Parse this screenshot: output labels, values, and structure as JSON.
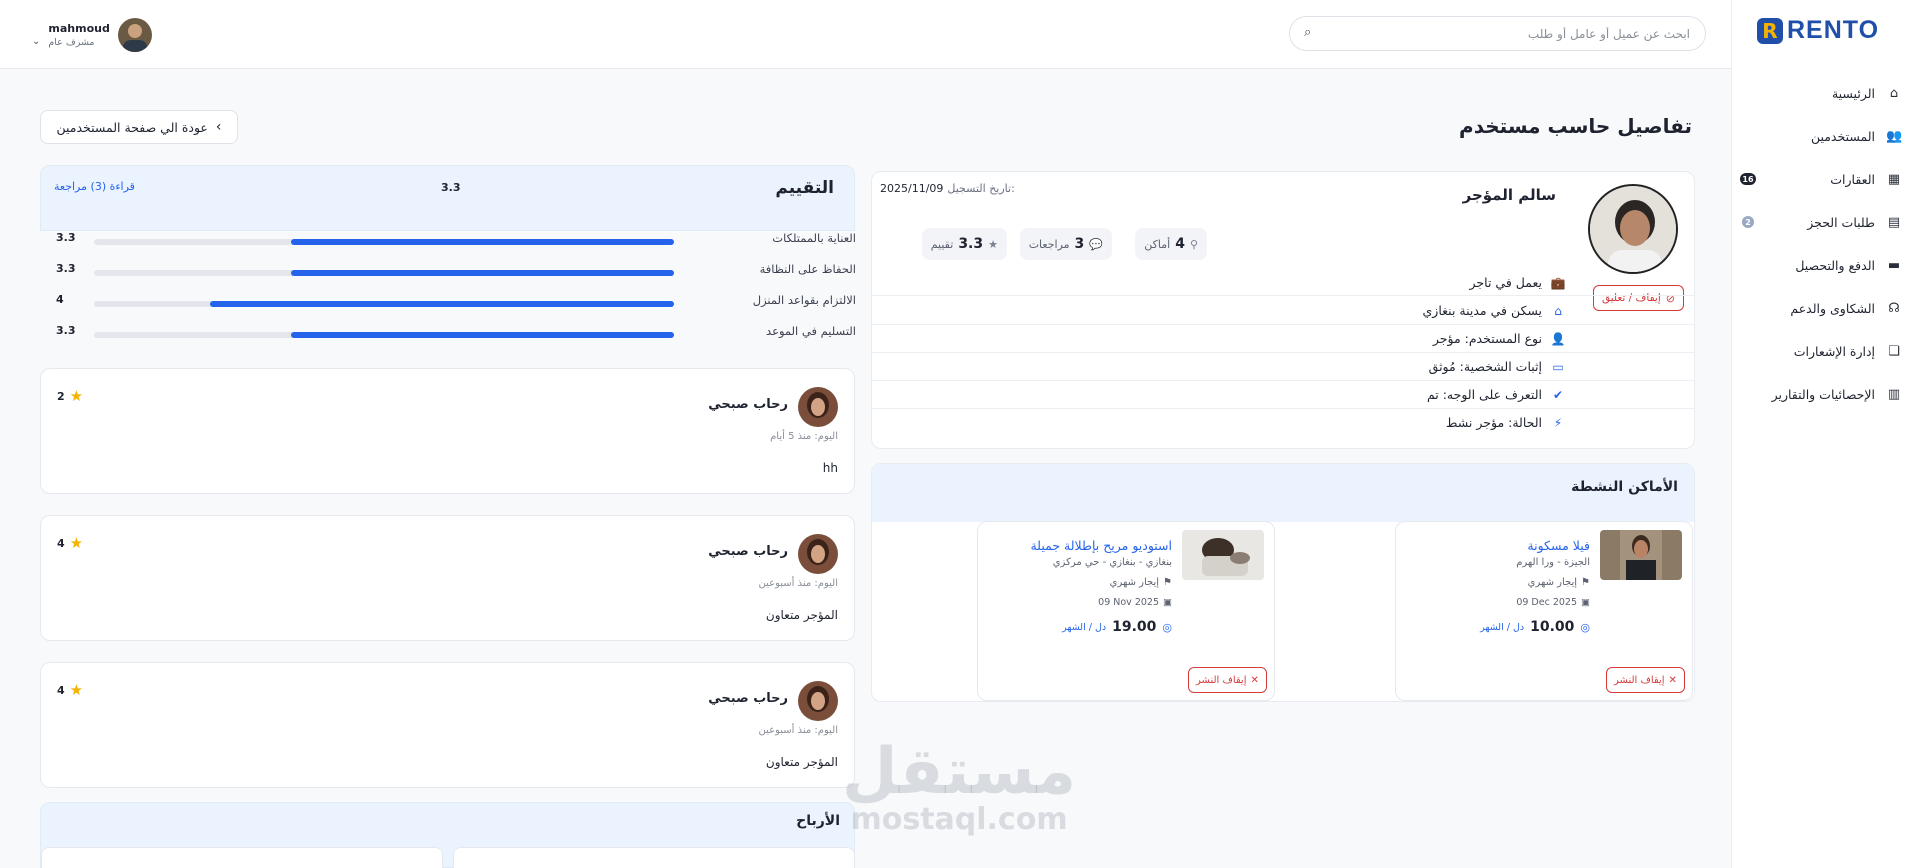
{
  "brand": {
    "name": "RENTO",
    "mark": "R"
  },
  "sidebar": {
    "items": [
      {
        "label": "الرئيسية",
        "icon": "home-icon"
      },
      {
        "label": "المستخدمين",
        "icon": "users-icon"
      },
      {
        "label": "العقارات",
        "icon": "building-icon",
        "badge": "16"
      },
      {
        "label": "طلبات الحجز",
        "icon": "clipboard-icon",
        "badge": "2"
      },
      {
        "label": "الدفع والتحصيل",
        "icon": "wallet-icon"
      },
      {
        "label": "الشكاوى والدعم",
        "icon": "headset-icon"
      },
      {
        "label": "إدارة الإشعارات",
        "icon": "gift-icon"
      },
      {
        "label": "الإحصائيات والتقارير",
        "icon": "chart-icon"
      }
    ]
  },
  "header": {
    "search_placeholder": "ابحث عن عميل أو عامل أو طلب",
    "user_name": "mahmoud",
    "user_role": "مشرف عام"
  },
  "page": {
    "title": "تفاصيل حاسب مستخدم",
    "back_label": "عودة الي صفحة المستخدمين"
  },
  "profile": {
    "name": "سالم المؤجر",
    "registered_label": "تاريخ التسجيل:",
    "registered_date": "2025/11/09",
    "suspend_label": "إيقاف / تعليق",
    "stats": [
      {
        "value": "4",
        "label": "أماكن",
        "icon": "location-pin-icon"
      },
      {
        "value": "3",
        "label": "مراجعات",
        "icon": "comments-icon"
      },
      {
        "value": "3.3",
        "label": "تقييم",
        "icon": "star-icon"
      }
    ],
    "details": [
      {
        "text": "يعمل في تاجر",
        "icon": "briefcase-icon"
      },
      {
        "text": "يسكن في مدينة بنغازي",
        "icon": "home-icon"
      },
      {
        "text": "نوع المستخدم: مؤجر",
        "icon": "user-icon"
      },
      {
        "text": "إثبات الشخصية: مُوثق",
        "icon": "id-card-icon"
      },
      {
        "text": "التعرف على الوجه: تم",
        "icon": "user-check-icon"
      },
      {
        "text": "الحالة: مؤجر نشط",
        "icon": "bolt-icon"
      }
    ]
  },
  "places": {
    "title": "الأماكن النشطة",
    "items": [
      {
        "title": "فيلا مسكونة",
        "location": "الجيزة - ورا الهرم",
        "rent_type": "إيجار شهري",
        "date": "09 Dec 2025",
        "price": "10.00",
        "unit": "دل / الشهر",
        "stop_label": "إيقاف النشر"
      },
      {
        "title": "استوديو مريح بإطلالة جميلة",
        "location": "بنغازي - بنغازي - حي مركزي",
        "rent_type": "إيجار شهري",
        "date": "09 Nov 2025",
        "price": "19.00",
        "unit": "دل / الشهر",
        "stop_label": "إيقاف النشر"
      }
    ]
  },
  "rating": {
    "title": "التقييم",
    "average": "3.3",
    "read_link": "قراءة (3) مراجعة",
    "criteria": [
      {
        "label": "العناية بالممتلكات",
        "value": 3.3,
        "value_text": "3.3"
      },
      {
        "label": "الحفاظ على النظافة",
        "value": 3.3,
        "value_text": "3.3"
      },
      {
        "label": "الالتزام بقواعد المنزل",
        "value": 4,
        "value_text": "4"
      },
      {
        "label": "التسليم في الموعد",
        "value": 3.3,
        "value_text": "3.3"
      }
    ],
    "max": 5
  },
  "reviews": [
    {
      "name": "رحاب صبحي",
      "time": "اليوم: منذ 5 أيام",
      "text": "hh",
      "stars": "2"
    },
    {
      "name": "رحاب صبحي",
      "time": "اليوم: منذ أسبوعين",
      "text": "المؤجر متعاون",
      "stars": "4"
    },
    {
      "name": "رحاب صبحي",
      "time": "اليوم: منذ أسبوعين",
      "text": "المؤجر متعاون",
      "stars": "4"
    }
  ],
  "earnings": {
    "title": "الأرباح"
  },
  "watermark": {
    "line1": "مستقل",
    "line2": "mostaql.com"
  }
}
